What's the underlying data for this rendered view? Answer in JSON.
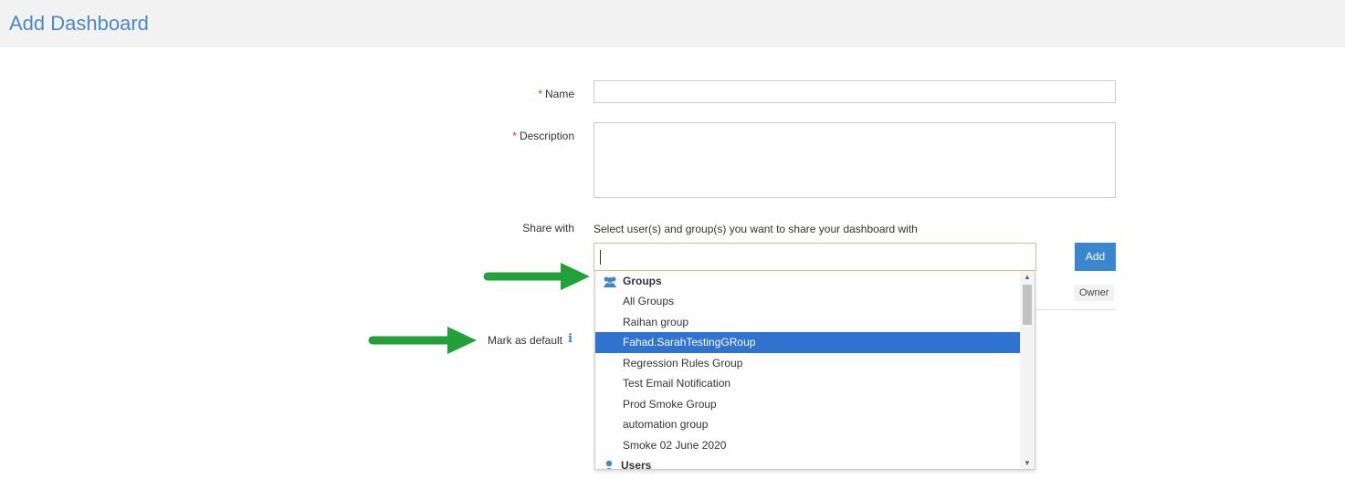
{
  "header": {
    "title": "Add Dashboard"
  },
  "form": {
    "name_label": "Name",
    "required_mark": "*",
    "description_label": "Description",
    "share_label": "Share with",
    "share_hint": "Select user(s) and group(s) you want to share your dashboard with",
    "add_label": "Add",
    "owner_label": "Owner",
    "mark_default_label": "Mark as default",
    "name_value": "",
    "description_value": "",
    "search_value": ""
  },
  "dropdown": {
    "groups_header": "Groups",
    "groups": [
      "All Groups",
      "Raihan group",
      "Fahad.SarahTestingGRoup",
      "Regression Rules Group",
      "Test Email Notification",
      "Prod Smoke Group",
      "automation group",
      "Smoke 02 June 2020"
    ],
    "selected_index": 2,
    "users_header": "Users"
  },
  "colors": {
    "accent": "#3a87d0",
    "selected": "#2f72d0",
    "arrow": "#22a03a",
    "title": "#4a8ac4"
  }
}
